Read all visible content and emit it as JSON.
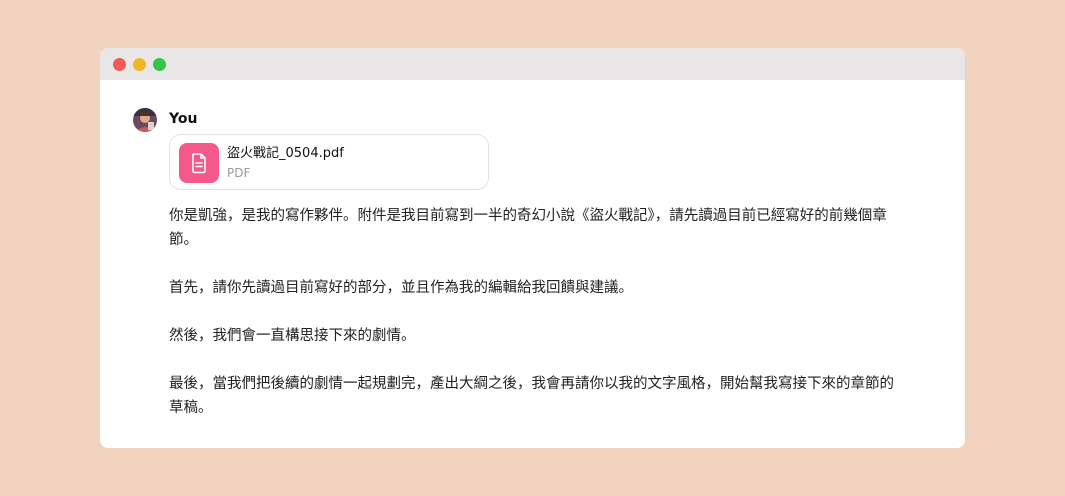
{
  "window": {
    "controls": [
      "close",
      "minimize",
      "maximize"
    ]
  },
  "message": {
    "sender": "You",
    "avatar_icon": "user-avatar",
    "attachment": {
      "icon": "document-icon",
      "icon_color": "#f5598a",
      "filename": "盜火戰記_0504.pdf",
      "type": "PDF"
    },
    "paragraphs": [
      "你是凱強，是我的寫作夥伴。附件是我目前寫到一半的奇幻小說《盜火戰記》，請先讀過目前已經寫好的前幾個章節。",
      "首先，請你先讀過目前寫好的部分，並且作為我的編輯給我回饋與建議。",
      "然後，我們會一直構思接下來的劇情。",
      "最後，當我們把後續的劇情一起規劃完，產出大綱之後，我會再請你以我的文字風格，開始幫我寫接下來的章節的草稿。"
    ]
  }
}
